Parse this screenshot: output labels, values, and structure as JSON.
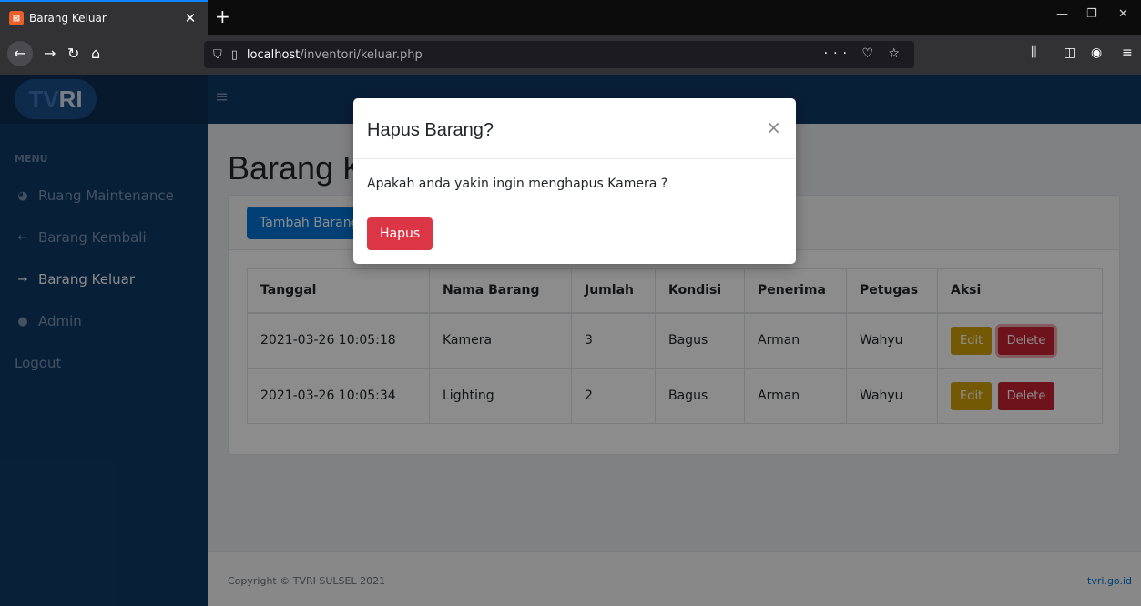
{
  "browser": {
    "tab_title": "Barang Keluar",
    "tab_close": "✕",
    "new_tab": "+",
    "url_host": "localhost",
    "url_path": "/inventori/keluar.php",
    "url_actions": "··· ♡ ☆"
  },
  "sidebar": {
    "logo_tv": "TV",
    "logo_ri": "RI",
    "menu_heading": "MENU",
    "items": [
      {
        "label": "Ruang Maintenance",
        "icon": "dashboard-icon",
        "active": false
      },
      {
        "label": "Barang Kembali",
        "icon": "arrow-left-icon",
        "active": false
      },
      {
        "label": "Barang Keluar",
        "icon": "arrow-right-icon",
        "active": true
      },
      {
        "label": "Admin",
        "icon": "user-icon",
        "active": false
      },
      {
        "label": "Logout",
        "icon": "",
        "active": false
      }
    ]
  },
  "main": {
    "page_title": "Barang Keluar",
    "add_button": "Tambah Barang",
    "table": {
      "headers": [
        "Tanggal",
        "Nama Barang",
        "Jumlah",
        "Kondisi",
        "Penerima",
        "Petugas",
        "Aksi"
      ],
      "rows": [
        [
          "2021-03-26 10:05:18",
          "Kamera",
          "3",
          "Bagus",
          "Arman",
          "Wahyu"
        ],
        [
          "2021-03-26 10:05:34",
          "Lighting",
          "2",
          "Bagus",
          "Arman",
          "Wahyu"
        ]
      ],
      "edit_label": "Edit",
      "delete_label": "Delete"
    }
  },
  "footer": {
    "copyright": "Copyright © TVRI SULSEL 2021",
    "link": "tvri.go.id"
  },
  "modal": {
    "title": "Hapus Barang?",
    "close": "×",
    "body": "Apakah anda yakin ingin menghapus Kamera ?",
    "confirm_button": "Hapus"
  },
  "colors": {
    "sidebar_bg": "#0f3a66",
    "primary": "#0275d8",
    "danger": "#dc3545",
    "warning": "#d4a208"
  }
}
